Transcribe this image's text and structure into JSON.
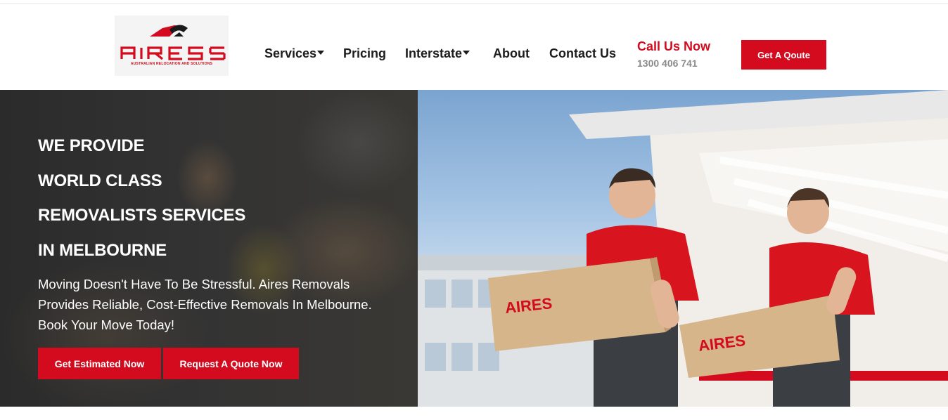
{
  "brand": {
    "name": "AIRES",
    "tagline": "AUSTRALIAN RELOCATION AND SOLUTIONS",
    "color": "#d40a1e"
  },
  "nav": {
    "items": [
      {
        "label": "Services",
        "dropdown": true
      },
      {
        "label": "Pricing",
        "dropdown": false
      },
      {
        "label": "Interstate",
        "dropdown": true
      },
      {
        "label": "About",
        "dropdown": false
      },
      {
        "label": "Contact Us",
        "dropdown": false
      }
    ]
  },
  "call": {
    "title": "Call Us Now",
    "number": "1300 406 741"
  },
  "header_cta": "Get A Qoute",
  "hero": {
    "headlines": [
      "WE PROVIDE",
      "WORLD CLASS",
      "REMOVALISTS SERVICES",
      "IN MELBOURNE"
    ],
    "subtext": "Moving Doesn't Have To Be Stressful. Aires Removals Provides Reliable, Cost-Effective Removals In Melbourne. Book Your Move Today!",
    "buttons": [
      "Get Estimated Now",
      "Request A Quote Now"
    ]
  },
  "colors": {
    "accent": "#d40a1e",
    "dark_panel": "#2f2f2f",
    "phone_gray": "#8a8a8a"
  }
}
